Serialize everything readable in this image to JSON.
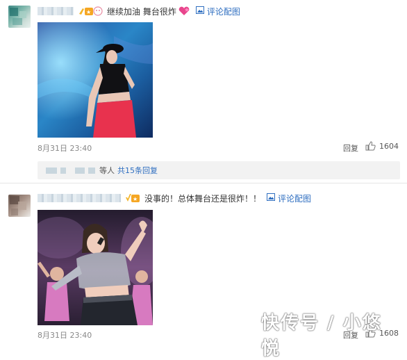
{
  "comments": [
    {
      "text": "继续加油 舞台很炸",
      "pic_link": "评论配图",
      "time": "8月31日 23:40",
      "reply": "回复",
      "likes": "1604",
      "sub_replies": {
        "suffix": "等人",
        "count": "共15条回复"
      }
    },
    {
      "text": "没事的！总体舞台还是很炸！！",
      "pic_link": "评论配图",
      "time": "8月31日 23:40",
      "reply": "回复",
      "likes": "1608"
    }
  ],
  "watermark": "快传号 / 小悠悦",
  "colors": {
    "link": "#2e6ec0",
    "reply_bg": "#f2f2f2"
  }
}
